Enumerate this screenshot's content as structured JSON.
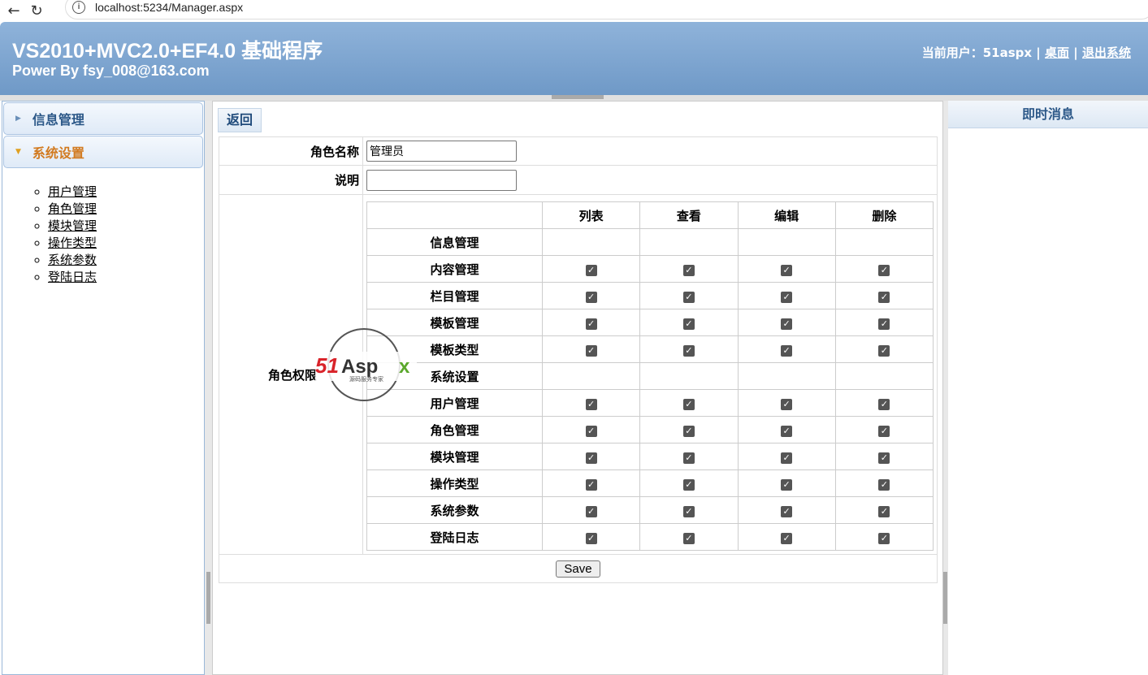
{
  "browser": {
    "url": "localhost:5234/Manager.aspx"
  },
  "header": {
    "title": "VS2010+MVC2.0+EF4.0 基础程序",
    "subtitle": "Power By fsy_008@163.com",
    "user_label": "当前用户：51aspx |",
    "desktop": "桌面",
    "sep": "|",
    "logout": "退出系统"
  },
  "sidebar": {
    "groups": [
      {
        "label": "信息管理",
        "open": false
      },
      {
        "label": "系统设置",
        "open": true
      }
    ],
    "items": [
      "用户管理",
      "角色管理",
      "模块管理",
      "操作类型",
      "系统参数",
      "登陆日志"
    ]
  },
  "main": {
    "back": "返回",
    "role_name_label": "角色名称",
    "role_name_value": "管理员",
    "desc_label": "说明",
    "desc_value": "",
    "perm_label": "角色权限",
    "columns": [
      "列表",
      "查看",
      "编辑",
      "删除"
    ],
    "rows": [
      {
        "name": "信息管理",
        "group": true
      },
      {
        "name": "内容管理",
        "checked": [
          true,
          true,
          true,
          true
        ]
      },
      {
        "name": "栏目管理",
        "checked": [
          true,
          true,
          true,
          true
        ]
      },
      {
        "name": "模板管理",
        "checked": [
          true,
          true,
          true,
          true
        ]
      },
      {
        "name": "模板类型",
        "checked": [
          true,
          true,
          true,
          true
        ]
      },
      {
        "name": "系统设置",
        "group": true
      },
      {
        "name": "用户管理",
        "checked": [
          true,
          true,
          true,
          true
        ]
      },
      {
        "name": "角色管理",
        "checked": [
          true,
          true,
          true,
          true
        ]
      },
      {
        "name": "模块管理",
        "checked": [
          true,
          true,
          true,
          true
        ]
      },
      {
        "name": "操作类型",
        "checked": [
          true,
          true,
          true,
          true
        ]
      },
      {
        "name": "系统参数",
        "checked": [
          true,
          true,
          true,
          true
        ]
      },
      {
        "name": "登陆日志",
        "checked": [
          true,
          true,
          true,
          true
        ]
      }
    ],
    "save": "Save"
  },
  "watermark": {
    "logo": "51Aspx",
    "tagline": "源码服务专家"
  },
  "right": {
    "title": "即时消息"
  }
}
